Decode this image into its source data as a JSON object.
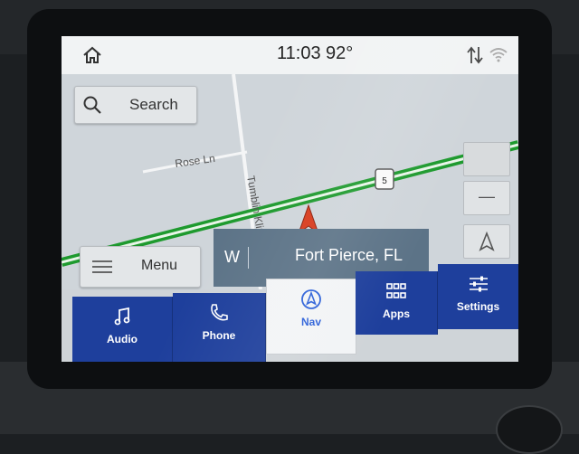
{
  "status_bar": {
    "time": "11:03",
    "temperature": "92°"
  },
  "search": {
    "label": "Search"
  },
  "map": {
    "street_rose": "Rose Ln",
    "street_tumblin": "Tumblin Kling Rd",
    "route_shield": "5",
    "colors": {
      "route": "#1e9a2e",
      "position_arrow": "#d83a1c"
    }
  },
  "map_controls": {
    "zoom_out": "—"
  },
  "menu": {
    "label": "Menu"
  },
  "destination": {
    "direction": "W",
    "name": "Fort Pierce, FL"
  },
  "nav_bar": {
    "items": [
      {
        "label": "Audio",
        "icon": "music-note-icon"
      },
      {
        "label": "Phone",
        "icon": "phone-icon"
      },
      {
        "label": "Nav",
        "icon": "navigation-icon",
        "active": true
      },
      {
        "label": "Apps",
        "icon": "grid-icon"
      },
      {
        "label": "Settings",
        "icon": "sliders-icon"
      }
    ],
    "colors": {
      "bar": "#1e3f9c",
      "active_text": "#2a5fd8"
    }
  }
}
